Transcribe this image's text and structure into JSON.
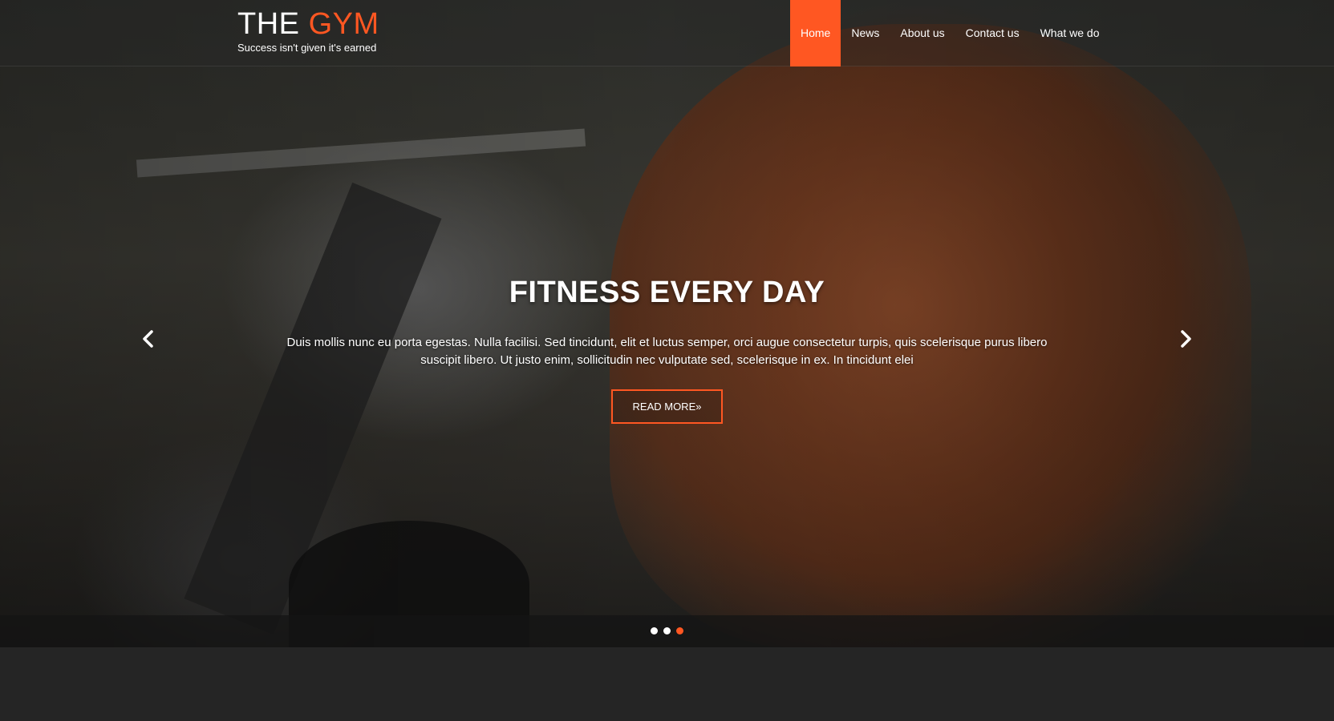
{
  "brand": {
    "title_main": "THE",
    "title_accent": "GYM",
    "tagline": "Success isn't given it's earned"
  },
  "nav": {
    "items": [
      {
        "label": "Home",
        "active": true
      },
      {
        "label": "News"
      },
      {
        "label": "About us"
      },
      {
        "label": "Contact us"
      },
      {
        "label": "What we do"
      }
    ]
  },
  "slider": {
    "title": "FITNESS EVERY DAY",
    "text": "Duis mollis nunc eu porta egestas. Nulla facilisi. Sed tincidunt, elit et luctus semper, orci augue consectetur turpis, quis scelerisque purus libero suscipit libero. Ut justo enim, sollicitudin nec vulputate sed, scelerisque in ex. In tincidunt elei",
    "button_label": "READ MORE»",
    "prev_icon": "chevron-left-icon",
    "next_icon": "chevron-right-icon",
    "dots": 3,
    "active_dot": 3
  },
  "colors": {
    "accent": "#ff5722",
    "footer_bg": "#252525"
  }
}
